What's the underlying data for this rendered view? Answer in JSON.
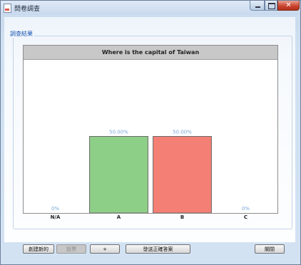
{
  "window": {
    "title": "問卷調查"
  },
  "group": {
    "label": "調查結果"
  },
  "chart_data": {
    "type": "bar",
    "title": "Where is the capital of Taiwan",
    "categories": [
      "N/A",
      "A",
      "B",
      "C"
    ],
    "values": [
      0,
      50,
      50,
      0
    ],
    "value_labels": [
      "0%",
      "50.00%",
      "50.00%",
      "0%"
    ],
    "ylim": [
      0,
      100
    ],
    "colors": [
      "#8ecf87",
      "#8ecf87",
      "#f47f74",
      "#8ecf87"
    ],
    "label_color": "#7aa7d8"
  },
  "buttons": {
    "create_new": "創建新的",
    "vote": "投票",
    "add": "+",
    "send_answer": "發送正確答案",
    "close": "關閉"
  },
  "colors": {
    "accent": "#1b55b3",
    "close_button": "#c8402a"
  }
}
